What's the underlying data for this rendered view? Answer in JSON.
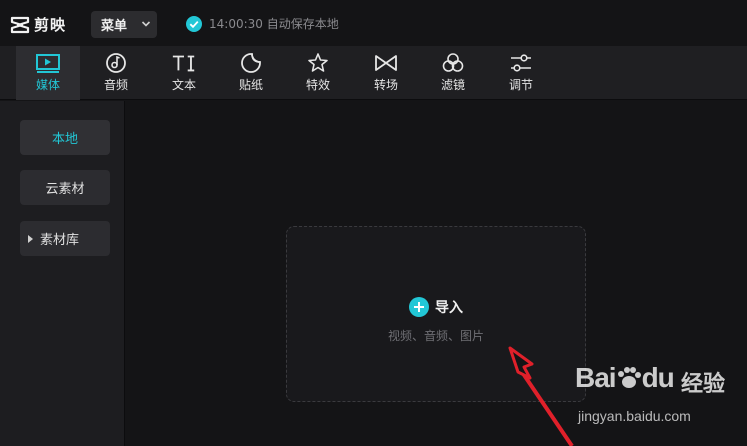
{
  "app": {
    "title": "剪映"
  },
  "titlebar": {
    "menu_label": "菜单",
    "save_status": "14:00:30 自动保存本地"
  },
  "toolbar": {
    "items": [
      {
        "label": "媒体",
        "icon": "media-icon",
        "active": true
      },
      {
        "label": "音频",
        "icon": "audio-icon"
      },
      {
        "label": "文本",
        "icon": "text-icon"
      },
      {
        "label": "贴纸",
        "icon": "sticker-icon"
      },
      {
        "label": "特效",
        "icon": "effects-icon"
      },
      {
        "label": "转场",
        "icon": "transition-icon"
      },
      {
        "label": "滤镜",
        "icon": "filter-icon"
      },
      {
        "label": "调节",
        "icon": "adjust-icon"
      }
    ]
  },
  "sidebar": {
    "items": [
      {
        "label": "本地",
        "active": true
      },
      {
        "label": "云素材"
      },
      {
        "label": "素材库",
        "expandable": true
      }
    ]
  },
  "import": {
    "label": "导入",
    "hint": "视频、音频、图片"
  },
  "watermark": {
    "brand": "Bai",
    "brand2": "du",
    "cn": "经验",
    "url": "jingyan.baidu.com"
  },
  "colors": {
    "accent": "#22c7d6",
    "background": "#141416",
    "panel": "#1d1d20",
    "annotation_arrow": "#e0202a"
  }
}
